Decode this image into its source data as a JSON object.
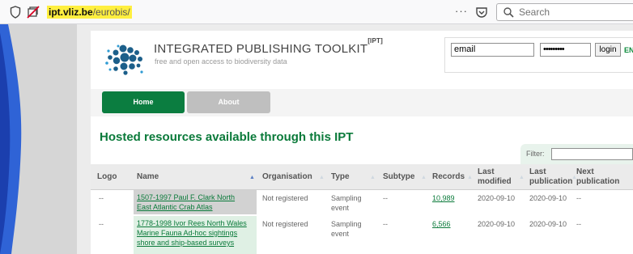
{
  "browser": {
    "url_host": "ipt.vliz.be",
    "url_path": "/eurobis/",
    "more_label": "···",
    "search_placeholder": "Search"
  },
  "header": {
    "title": "INTEGRATED PUBLISHING TOOLKIT",
    "title_sup": "[IPT]",
    "tagline": "free and open access to biodiversity data",
    "email_value": "email",
    "password_value": "•••••••••",
    "login_label": "login",
    "language_label": "ENGLI"
  },
  "nav": {
    "home_label": "Home",
    "about_label": "About"
  },
  "main": {
    "title": "Hosted resources available through this IPT",
    "filter_label": "Filter:",
    "columns": [
      {
        "line1": "Logo",
        "line2": ""
      },
      {
        "line1": "Name",
        "line2": ""
      },
      {
        "line1": "Organisation",
        "line2": ""
      },
      {
        "line1": "Type",
        "line2": ""
      },
      {
        "line1": "Subtype",
        "line2": ""
      },
      {
        "line1": "Records",
        "line2": ""
      },
      {
        "line1": "Last",
        "line2": "modified"
      },
      {
        "line1": "Last",
        "line2": "publication"
      },
      {
        "line1": "Next",
        "line2": "publication"
      }
    ],
    "rows": [
      {
        "logo": "--",
        "name_lines": [
          "1507-1997 Paul F. Clark North",
          "East Atlantic Crab Atlas"
        ],
        "organisation": "Not registered",
        "type_lines": [
          "Sampling",
          "event"
        ],
        "subtype": "--",
        "records": "10,989",
        "last_modified": "2020-09-10",
        "last_publication": "2020-09-10",
        "next_publication": "--"
      },
      {
        "logo": "--",
        "name_lines": [
          "1778-1998 Ivor Rees North Wales",
          "Marine Fauna Ad-hoc sightings",
          "shore and ship-based surveys"
        ],
        "organisation": "Not registered",
        "type_lines": [
          "Sampling",
          "event"
        ],
        "subtype": "--",
        "records": "6,566",
        "last_modified": "2020-09-10",
        "last_publication": "2020-09-10",
        "next_publication": "--"
      }
    ]
  },
  "colors": {
    "brand_green": "#0b7d40",
    "heading_green": "#0a7a3a",
    "url_highlight": "#ffef3f"
  }
}
